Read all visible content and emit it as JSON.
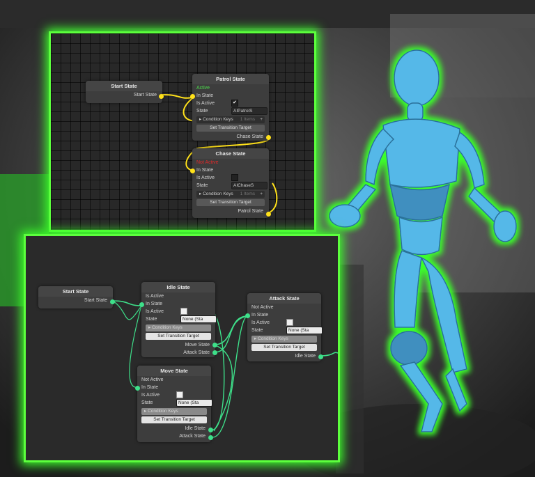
{
  "colors": {
    "accent_glow": "#5cff3d",
    "port_yellow": "#ffe11a",
    "port_green": "#3ee08a",
    "active_text": "#4ddc4d",
    "inactive_text": "#e02a2a",
    "robot_body": "#55b8e8"
  },
  "top_graph": {
    "start_node": {
      "title": "Start State",
      "out_label": "Start State"
    },
    "patrol_node": {
      "title": "Patrol State",
      "status": "Active",
      "in_label": "In State",
      "is_active_label": "Is Active",
      "state_label": "State",
      "state_value": "AIPatrolS",
      "condition_keys_label": "Condition Keys",
      "condition_count": "1 Items",
      "transition_button": "Set Transition Target",
      "out_label": "Chase State"
    },
    "chase_node": {
      "title": "Chase State",
      "status": "Not Active",
      "in_label": "In State",
      "is_active_label": "Is Active",
      "state_label": "State",
      "state_value": "AIChaseS",
      "condition_keys_label": "Condition Keys",
      "condition_count": "1 Items",
      "transition_button": "Set Transition Target",
      "out_label": "Patrol State"
    }
  },
  "bottom_graph": {
    "start_node": {
      "title": "Start State",
      "out_label": "Start State"
    },
    "idle_node": {
      "title": "Idle State",
      "status": "Is Active",
      "in_label": "In State",
      "is_active_label": "Is Active",
      "state_label": "State",
      "state_value": "None (Sta",
      "condition_keys_label": "Condition Keys",
      "transition_button": "Set Transition Target",
      "out1": "Move State",
      "out2": "Attack State"
    },
    "attack_node": {
      "title": "Attack State",
      "status": "Not Active",
      "in_label": "In State",
      "is_active_label": "Is Active",
      "state_label": "State",
      "state_value": "None (Sta",
      "condition_keys_label": "Condition Keys",
      "transition_button": "Set Transition Target",
      "out1": "Idle State"
    },
    "move_node": {
      "title": "Move State",
      "status": "Not Active",
      "in_label": "In State",
      "is_active_label": "Is Active",
      "state_label": "State",
      "state_value": "None (Sta",
      "condition_keys_label": "Condition Keys",
      "transition_button": "Set Transition Target",
      "out1": "Idle State",
      "out2": "Attack State"
    }
  }
}
